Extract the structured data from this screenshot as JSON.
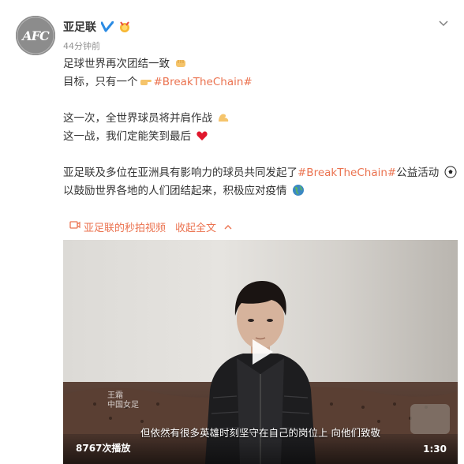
{
  "post": {
    "username": "亚足联",
    "timestamp": "44分钟前",
    "avatar_text": "AFC",
    "verified_icon": "verified-v-icon",
    "medal_icon": "fan-medal-icon",
    "menu_icon": "chevron-down-icon"
  },
  "content": {
    "line1": "足球世界再次团结一致",
    "line2_prefix": "目标，只有一个",
    "line2_tag": "#BreakTheChain#",
    "line3": "这一次，全世界球员将并肩作战",
    "line4": "这一战，我们定能笑到最后",
    "line5_prefix": "亚足联及多位在亚洲具有影响力的球员共同发起了",
    "line5_tag": "#BreakTheChain#",
    "line5_suffix": "公益活动",
    "line6": "以鼓励世界各地的人们团结起来，积极应对疫情"
  },
  "actions": {
    "video_link": "亚足联的秒拍视频",
    "collapse": "收起全文"
  },
  "video": {
    "subtitle": "但依然有很多英雄时刻坚守在自己的岗位上   向他们致敬",
    "play_count": "8767次播放",
    "duration": "1:30",
    "watermark_line1": "王霜",
    "watermark_line2": "中国女足"
  },
  "colors": {
    "accent": "#eb7350",
    "verified": "#2b8be3",
    "text": "#333333",
    "muted": "#939393"
  }
}
